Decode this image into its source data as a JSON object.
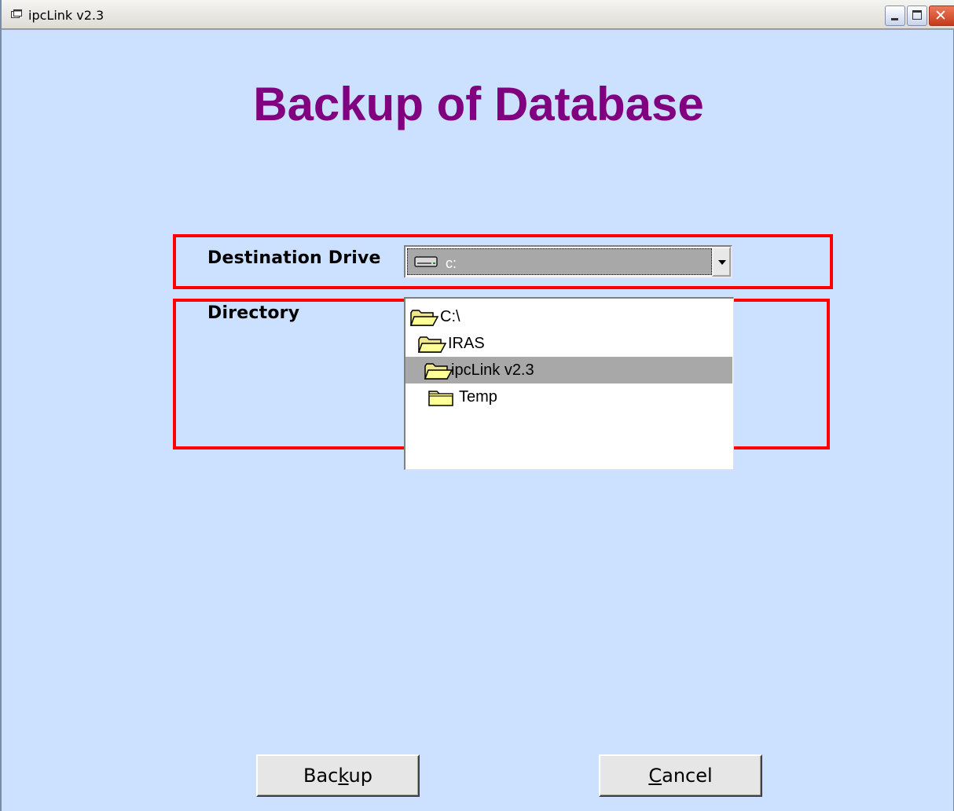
{
  "window": {
    "title": "ipcLink v2.3",
    "close_glyph": "✕"
  },
  "page": {
    "heading": "Backup of Database"
  },
  "form": {
    "destination_label": "Destination Drive",
    "directory_label": "Directory",
    "drive": {
      "selected_value": "c:",
      "icon": "hard-drive-icon"
    },
    "directories": [
      {
        "label": "C:\\",
        "indent": 0,
        "state": "open",
        "selected": false
      },
      {
        "label": "IRAS",
        "indent": 1,
        "state": "open",
        "selected": false
      },
      {
        "label": "ipcLink v2.3",
        "indent": 2,
        "state": "open",
        "selected": true
      },
      {
        "label": "Temp",
        "indent": 3,
        "state": "closed",
        "selected": false
      }
    ]
  },
  "actions": {
    "backup": {
      "before": "Bac",
      "mnemonic": "k",
      "after": "up"
    },
    "cancel": {
      "before": "",
      "mnemonic": "C",
      "after": "ancel"
    }
  },
  "colors": {
    "background": "#cce0ff",
    "heading": "#800080",
    "highlight_frame": "#ff0000",
    "selection": "#a8a8a8"
  }
}
